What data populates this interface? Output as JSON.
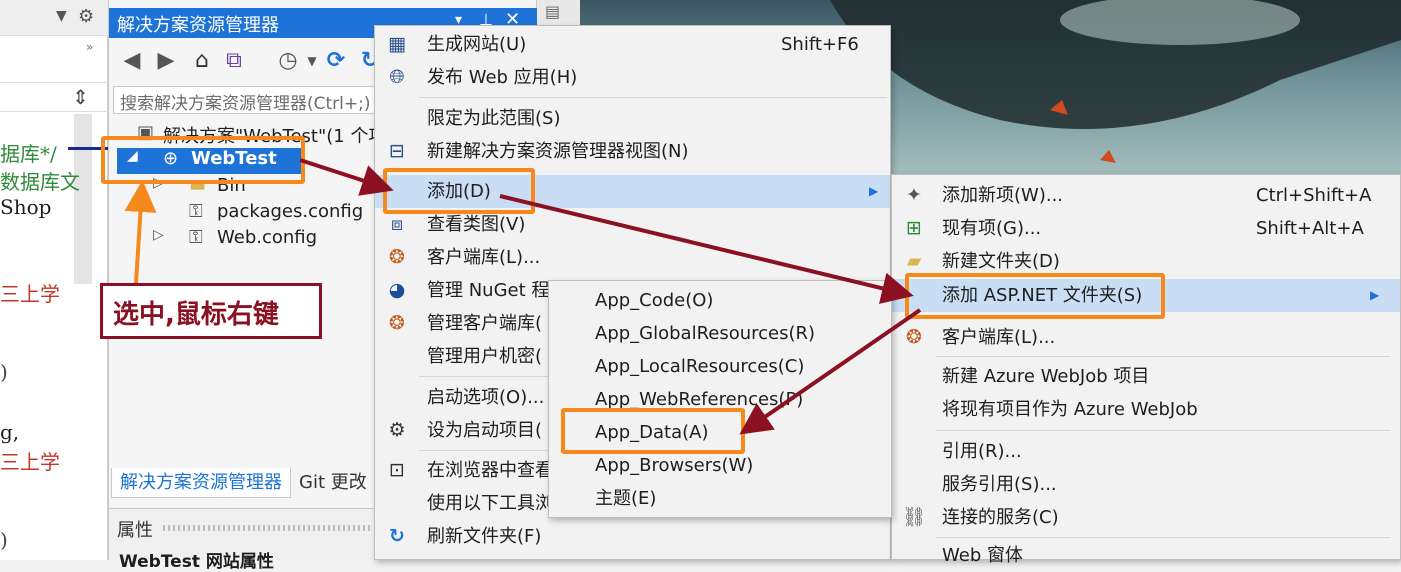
{
  "left_pane": {
    "lines": [
      "据库*/",
      "数据库文",
      "Shop",
      "三上学",
      ")",
      "g,",
      "三上学",
      ")"
    ]
  },
  "solution_explorer": {
    "title": "解决方案资源管理器",
    "search_placeholder": "搜索解决方案资源管理器(Ctrl+;)",
    "tree": {
      "solution": "解决方案\"WebTest\"(1 个项",
      "project": "WebTest",
      "bin": "Bin",
      "packages": "packages.config",
      "webconfig": "Web.config"
    },
    "tabs": [
      "解决方案资源管理器",
      "Git 更改"
    ],
    "properties_title": "属性",
    "properties_item": "WebTest 网站属性"
  },
  "callout": "选中,鼠标右键",
  "context_menu": [
    {
      "icon": "build-icon",
      "label": "生成网站(U)",
      "shortcut": "Shift+F6"
    },
    {
      "icon": "globe-icon",
      "label": "发布 Web 应用(H)",
      "shortcut": ""
    },
    {
      "icon": "",
      "label": "限定为此范围(S)",
      "shortcut": ""
    },
    {
      "icon": "new-view-icon",
      "label": "新建解决方案资源管理器视图(N)",
      "shortcut": ""
    },
    {
      "icon": "",
      "label": "添加(D)",
      "shortcut": ""
    },
    {
      "icon": "class-diagram-icon",
      "label": "查看类图(V)",
      "shortcut": ""
    },
    {
      "icon": "client-lib-icon",
      "label": "客户端库(L)...",
      "shortcut": ""
    },
    {
      "icon": "nuget-icon",
      "label": "管理 NuGet 程",
      "shortcut": ""
    },
    {
      "icon": "client-lib-icon",
      "label": "管理客户端库(",
      "shortcut": ""
    },
    {
      "icon": "",
      "label": "管理用户机密(",
      "shortcut": ""
    },
    {
      "icon": "",
      "label": "启动选项(O)...",
      "shortcut": ""
    },
    {
      "icon": "gear-icon",
      "label": "设为启动项目(",
      "shortcut": ""
    },
    {
      "icon": "browser-icon",
      "label": "在浏览器中查看",
      "shortcut": ""
    },
    {
      "icon": "",
      "label": "使用以下工具浏",
      "shortcut": ""
    },
    {
      "icon": "refresh-icon",
      "label": "刷新文件夹(F)",
      "shortcut": ""
    }
  ],
  "add_submenu": [
    {
      "icon": "new-item-icon",
      "label": "添加新项(W)...",
      "shortcut": "Ctrl+Shift+A"
    },
    {
      "icon": "existing-item-icon",
      "label": "现有项(G)...",
      "shortcut": "Shift+Alt+A"
    },
    {
      "icon": "new-folder-icon",
      "label": "新建文件夹(D)",
      "shortcut": ""
    },
    {
      "icon": "",
      "label": "添加 ASP.NET 文件夹(S)",
      "shortcut": ""
    },
    {
      "icon": "client-lib-icon",
      "label": "客户端库(L)...",
      "shortcut": ""
    },
    {
      "icon": "",
      "label": "新建 Azure WebJob 项目",
      "shortcut": ""
    },
    {
      "icon": "",
      "label": "将现有项目作为 Azure WebJob",
      "shortcut": ""
    },
    {
      "icon": "",
      "label": "引用(R)...",
      "shortcut": ""
    },
    {
      "icon": "",
      "label": "服务引用(S)...",
      "shortcut": ""
    },
    {
      "icon": "connected-service-icon",
      "label": "连接的服务(C)",
      "shortcut": ""
    },
    {
      "icon": "",
      "label": "Web 窗体",
      "shortcut": ""
    }
  ],
  "aspnet_submenu": [
    "App_Code(O)",
    "App_GlobalResources(R)",
    "App_LocalResources(C)",
    "App_WebReferences(P)",
    "App_Data(A)",
    "App_Browsers(W)",
    "主题(E)"
  ],
  "colors": {
    "accent": "#1e73d8",
    "highlight": "#c9def5",
    "annotation": "#f5891c",
    "arrow": "#8b1021"
  }
}
